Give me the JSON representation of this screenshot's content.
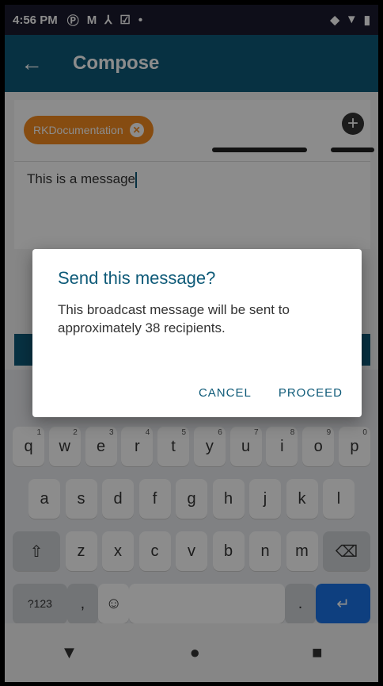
{
  "status_bar": {
    "time": "4:56 PM",
    "left_icons": [
      "P-icon",
      "M-icon",
      "network-icon",
      "check-icon",
      "dot"
    ],
    "right_icons": [
      "vpn-icon",
      "wifi-icon",
      "battery-icon"
    ]
  },
  "app_bar": {
    "title": "Compose",
    "back_icon": "arrow-left-icon"
  },
  "compose": {
    "recipient_chip": "RKDocumentation",
    "message": "This is a message"
  },
  "dialog": {
    "title": "Send this message?",
    "body": "This broadcast message will be sent to approximately 38 recipients.",
    "cancel": "CANCEL",
    "proceed": "PROCEED"
  },
  "keyboard": {
    "row1": [
      "q",
      "w",
      "e",
      "r",
      "t",
      "y",
      "u",
      "i",
      "o",
      "p"
    ],
    "row1_hints": [
      "1",
      "2",
      "3",
      "4",
      "5",
      "6",
      "7",
      "8",
      "9",
      "0"
    ],
    "row2": [
      "a",
      "s",
      "d",
      "f",
      "g",
      "h",
      "j",
      "k",
      "l"
    ],
    "row3": [
      "z",
      "x",
      "c",
      "v",
      "b",
      "n",
      "m"
    ],
    "symbols_key": "?123",
    "comma_key": ",",
    "period_key": "."
  },
  "colors": {
    "accent": "#0e5a78",
    "chip": "#f58a1f"
  }
}
